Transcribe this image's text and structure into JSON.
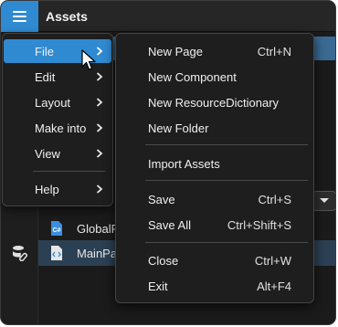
{
  "window": {
    "title": "Assets"
  },
  "colors": {
    "accent": "#2f8ad1",
    "menu_bg": "#1e1e1e",
    "selected_row": "#2c4053"
  },
  "files": [
    {
      "name": "GlobalR",
      "icon": "csharp-file-icon",
      "selected": false
    },
    {
      "name": "MainPa",
      "icon": "xaml-file-icon",
      "selected": true
    }
  ],
  "menu": {
    "items": [
      {
        "label": "File",
        "active": true
      },
      {
        "label": "Edit"
      },
      {
        "label": "Layout"
      },
      {
        "label": "Make into"
      },
      {
        "label": "View"
      },
      {
        "label": "Help"
      }
    ]
  },
  "submenu": {
    "items": [
      {
        "label": "New Page",
        "shortcut": "Ctrl+N"
      },
      {
        "label": "New Component",
        "shortcut": ""
      },
      {
        "label": "New ResourceDictionary",
        "shortcut": ""
      },
      {
        "label": "New Folder",
        "shortcut": ""
      },
      {
        "label": "Import Assets",
        "shortcut": ""
      },
      {
        "label": "Save",
        "shortcut": "Ctrl+S"
      },
      {
        "label": "Save All",
        "shortcut": "Ctrl+Shift+S"
      },
      {
        "label": "Close",
        "shortcut": "Ctrl+W"
      },
      {
        "label": "Exit",
        "shortcut": "Alt+F4"
      }
    ]
  }
}
